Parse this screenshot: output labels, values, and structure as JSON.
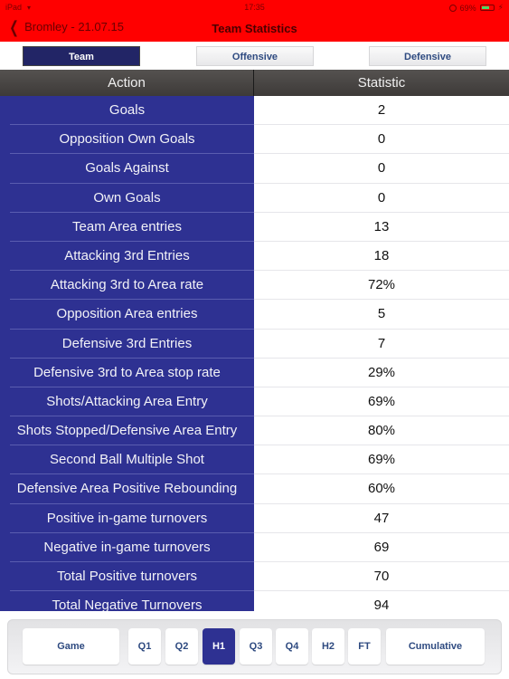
{
  "status_bar": {
    "device": "iPad",
    "time": "17:35",
    "battery": "69%",
    "battery_level": 0.69
  },
  "nav": {
    "back_label": "Bromley - 21.07.15",
    "title": "Team Statistics"
  },
  "segments": [
    {
      "label": "Team",
      "active": true
    },
    {
      "label": "Offensive",
      "active": false
    },
    {
      "label": "Defensive",
      "active": false
    }
  ],
  "table": {
    "headers": [
      "Action",
      "Statistic"
    ],
    "rows": [
      {
        "action": "Goals",
        "statistic": "2"
      },
      {
        "action": "Opposition Own Goals",
        "statistic": "0"
      },
      {
        "action": "Goals Against",
        "statistic": "0"
      },
      {
        "action": "Own Goals",
        "statistic": "0"
      },
      {
        "action": "Team Area entries",
        "statistic": "13"
      },
      {
        "action": "Attacking 3rd Entries",
        "statistic": "18"
      },
      {
        "action": "Attacking 3rd to Area rate",
        "statistic": "72%"
      },
      {
        "action": "Opposition Area entries",
        "statistic": "5"
      },
      {
        "action": "Defensive 3rd Entries",
        "statistic": "7"
      },
      {
        "action": "Defensive 3rd to Area stop rate",
        "statistic": "29%"
      },
      {
        "action": "Shots/Attacking Area Entry",
        "statistic": "69%"
      },
      {
        "action": "Shots Stopped/Defensive Area Entry",
        "statistic": "80%"
      },
      {
        "action": "Second Ball Multiple Shot",
        "statistic": "69%"
      },
      {
        "action": "Defensive Area Positive Rebounding",
        "statistic": "60%"
      },
      {
        "action": "Positive in-game turnovers",
        "statistic": "47"
      },
      {
        "action": "Negative in-game turnovers",
        "statistic": "69"
      },
      {
        "action": "Total Positive turnovers",
        "statistic": "70"
      },
      {
        "action": "Total Negative Turnovers",
        "statistic": "94"
      }
    ]
  },
  "periods": [
    {
      "label": "Game",
      "active": false
    },
    {
      "label": "Q1",
      "active": false
    },
    {
      "label": "Q2",
      "active": false
    },
    {
      "label": "H1",
      "active": true
    },
    {
      "label": "Q3",
      "active": false
    },
    {
      "label": "Q4",
      "active": false
    },
    {
      "label": "H2",
      "active": false
    },
    {
      "label": "FT",
      "active": false
    },
    {
      "label": "Cumulative",
      "active": false
    }
  ],
  "colors": {
    "nav_bar": "#ff0000",
    "action_column": "#2e3192",
    "active_segment": "#222566",
    "active_period": "#2e3192"
  }
}
